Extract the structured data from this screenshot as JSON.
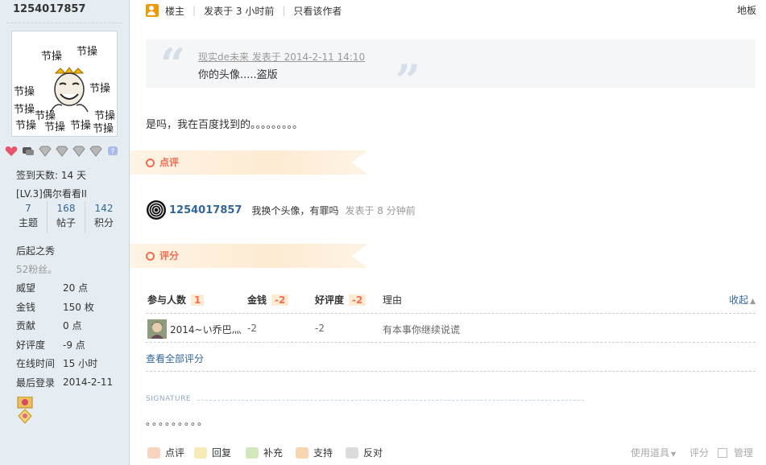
{
  "sidebar": {
    "username": "1254017857",
    "avatar_words": "节操",
    "checkin": "签到天数: 14 天",
    "level": "[LV.3]偶尔看看II",
    "counts": [
      {
        "num": "7",
        "label": "主题"
      },
      {
        "num": "168",
        "label": "帖子"
      },
      {
        "num": "142",
        "label": "积分"
      }
    ],
    "user_title": "后起之秀",
    "fans": "52粉丝。",
    "props": [
      {
        "key": "威望",
        "val": "20 点"
      },
      {
        "key": "金钱",
        "val": "150 枚"
      },
      {
        "key": "贡献",
        "val": "0 点"
      },
      {
        "key": "好评度",
        "val": "-9 点"
      },
      {
        "key": "在线时间",
        "val": "15 小时"
      },
      {
        "key": "最后登录",
        "val": "2014-2-11"
      }
    ]
  },
  "post": {
    "host_label": "楼主",
    "posted": "发表于 3 小时前",
    "only_author": "只看该作者",
    "floor": "地板",
    "quote_meta": "现实de未来 发表于 2014-2-11 14:10",
    "quote_text": "你的头像.....盗版",
    "reply": "是吗，我在百度找到的。。。。。。。。。"
  },
  "comments": {
    "label": "点评",
    "items": [
      {
        "user": "1254017857",
        "text": "我换个头像，有罪吗",
        "time": "发表于 8 分钟前"
      }
    ]
  },
  "rating": {
    "label": "评分",
    "headers": {
      "participants": "参与人数",
      "participants_count": "1",
      "money": "金钱",
      "money_total": "-2",
      "rep": "好评度",
      "rep_total": "-2",
      "reason": "理由",
      "collapse": "收起"
    },
    "rows": [
      {
        "user": "2014~い乔巴灬",
        "money": "-2",
        "rep": "-2",
        "reason": "有本事你继续说谎"
      }
    ],
    "view_all": "查看全部评分"
  },
  "signature": {
    "label": "SIGNATURE",
    "text": "。。。。。。。。。"
  },
  "actions": {
    "comment": "点评",
    "reply": "回复",
    "supplement": "补充",
    "support": "支持",
    "oppose": "反对",
    "use_tool": "使用道具",
    "rate": "评分",
    "manage": "管理"
  },
  "colors": {
    "sidebar_bg": "#e5edf2",
    "link": "#336699",
    "accent": "#f26c4f",
    "ribbon": "#fdebd3"
  }
}
